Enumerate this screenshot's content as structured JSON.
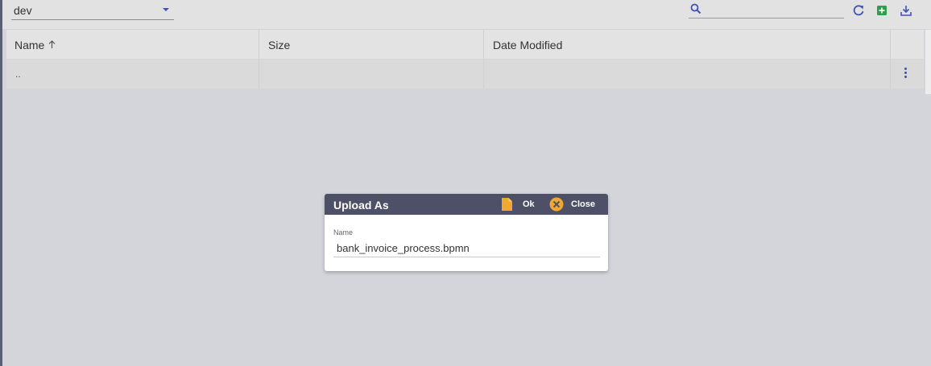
{
  "toolbar": {
    "folder_value": "dev",
    "search_placeholder": "",
    "icons": [
      "search-icon",
      "refresh-icon",
      "add-file-icon",
      "download-icon"
    ]
  },
  "table": {
    "columns": [
      "Name",
      "Size",
      "Date Modified"
    ],
    "sort_column": "Name",
    "sort_direction": "ascending",
    "rows": [
      {
        "name": "..",
        "size": "",
        "date_modified": ""
      }
    ]
  },
  "dialog": {
    "title": "Upload As",
    "ok_label": "Ok",
    "close_label": "Close",
    "field_label": "Name",
    "field_value": "bank_invoice_process.bpmn"
  },
  "colors": {
    "accent": "#3f51b5",
    "dialog_header": "#4d5066",
    "icon_orange": "#f0a830",
    "add_green": "#2e9e4a",
    "overlay": "#d3d5da"
  }
}
